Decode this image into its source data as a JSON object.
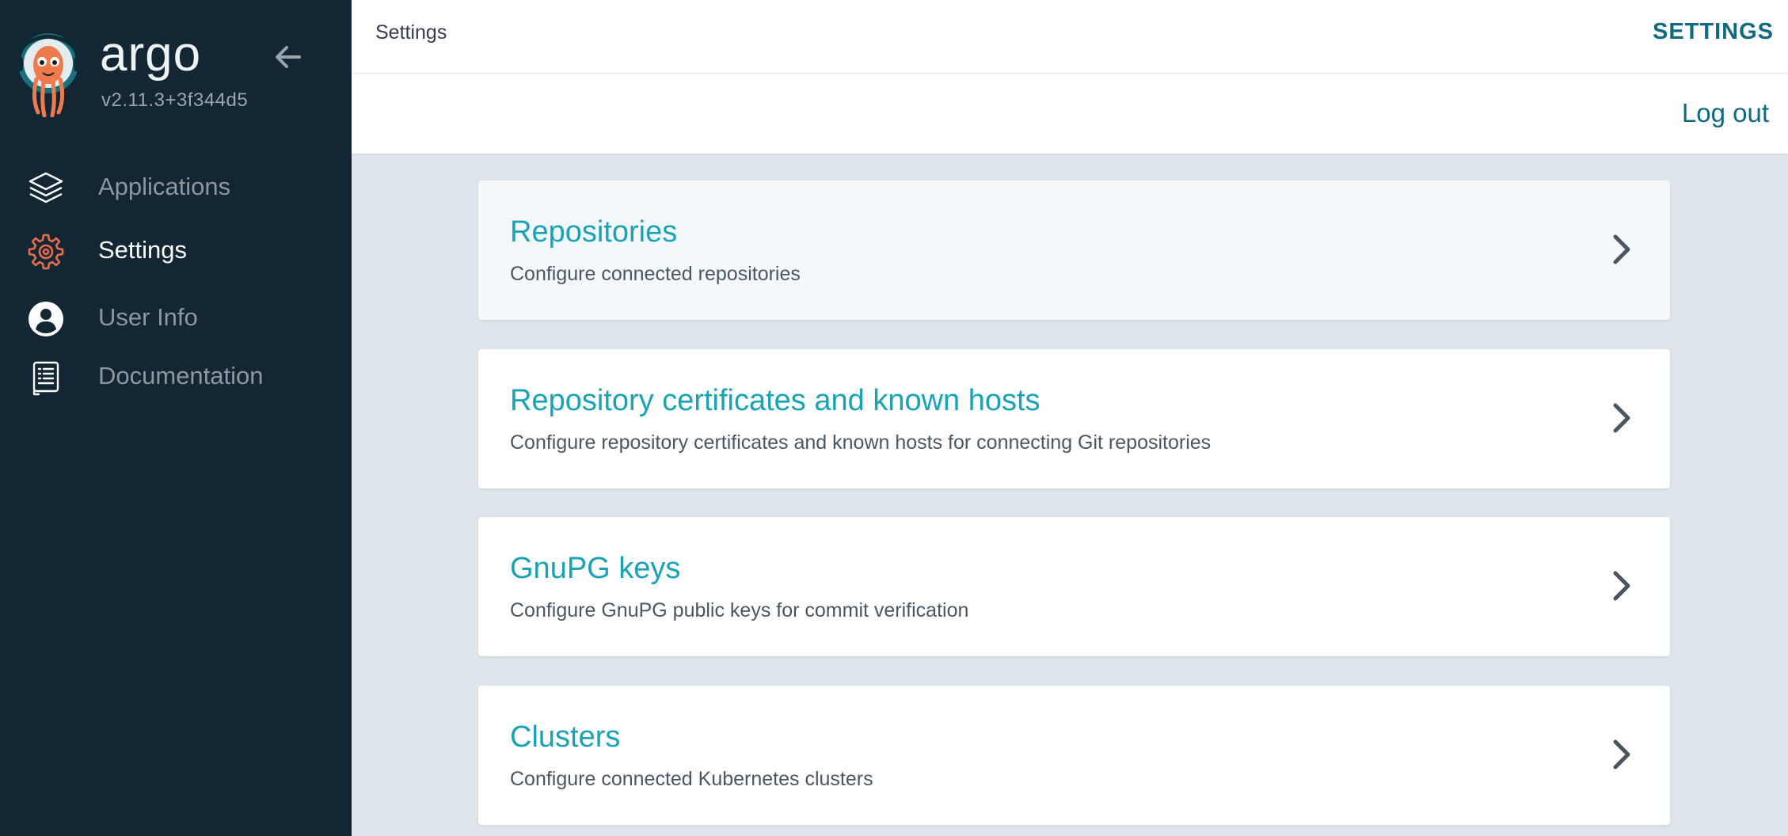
{
  "brand": {
    "name": "argo",
    "version": "v2.11.3+3f344d5"
  },
  "sidebar": {
    "items": [
      {
        "label": "Applications",
        "icon": "layers-icon",
        "active": false
      },
      {
        "label": "Settings",
        "icon": "gear-icon",
        "active": true
      },
      {
        "label": "User Info",
        "icon": "user-circle-icon",
        "active": false
      },
      {
        "label": "Documentation",
        "icon": "book-icon",
        "active": false
      }
    ]
  },
  "topbar": {
    "breadcrumb": "Settings",
    "title": "SETTINGS"
  },
  "actions": {
    "logout": "Log out"
  },
  "cards": [
    {
      "title": "Repositories",
      "description": "Configure connected repositories"
    },
    {
      "title": "Repository certificates and known hosts",
      "description": "Configure repository certificates and known hosts for connecting Git repositories"
    },
    {
      "title": "GnuPG keys",
      "description": "Configure GnuPG public keys for commit verification"
    },
    {
      "title": "Clusters",
      "description": "Configure connected Kubernetes clusters"
    }
  ],
  "colors": {
    "sidebar_bg": "#132633",
    "accent_teal": "#18a3b6",
    "dark_teal": "#0d6a7f",
    "active_icon": "#e96d4c",
    "content_bg": "#dee6eb"
  }
}
